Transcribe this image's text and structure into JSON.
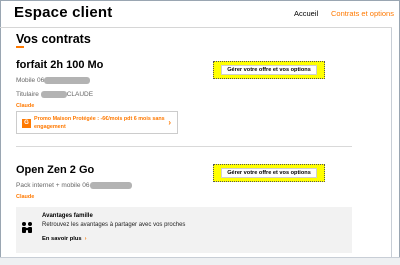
{
  "header": {
    "brand": "Espace client",
    "nav": {
      "accueil": "Accueil",
      "contrats": "Contrats et options"
    }
  },
  "page": {
    "title": "Vos contrats"
  },
  "contracts": [
    {
      "name": "forfait 2h 100 Mo",
      "line1_prefix": "Mobile 06",
      "line2_prefix": "Titulaire",
      "line2_suffix": "CLAUDE",
      "owner": "Claude",
      "manage_label": "Gérer votre offre et vos options",
      "promo": {
        "icon_letter": "G",
        "text": "Promo Maison Protégée : -6€/mois pdt 6 mois sans engagement",
        "chevron": "›"
      }
    },
    {
      "name": "Open Zen 2 Go",
      "line1_prefix": "Pack internet + mobile 06",
      "owner": "Claude",
      "manage_label": "Gérer votre offre et vos options"
    }
  ],
  "family": {
    "title": "Avantages famille",
    "description": "Retrouvez les avantages à partager avec vos proches",
    "link_label": "En savoir plus",
    "link_chevron": "›",
    "icon": "family-icon"
  },
  "colors": {
    "accent": "#ff7900",
    "highlight": "#ffff00",
    "card": "#f2f2f2"
  }
}
